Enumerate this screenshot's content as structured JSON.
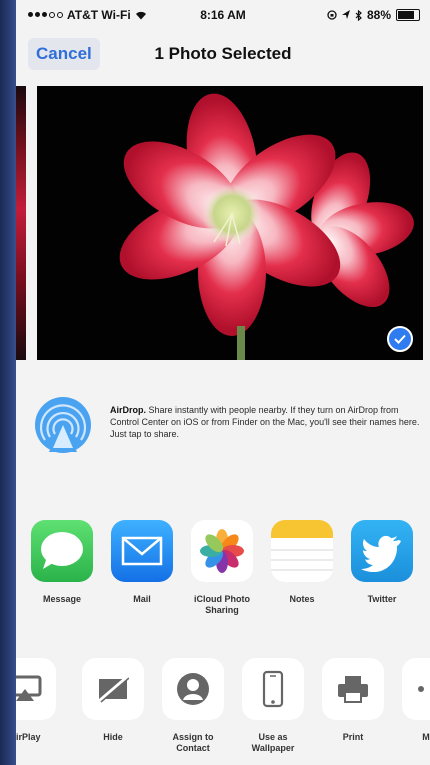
{
  "status_bar": {
    "carrier": "AT&T Wi-Fi",
    "time": "8:16 AM",
    "battery": "88%",
    "battery_level": 0.88
  },
  "nav": {
    "cancel_label": "Cancel",
    "title": "1 Photo Selected"
  },
  "airdrop": {
    "title": "AirDrop.",
    "description": "Share instantly with people nearby. If they turn on AirDrop from Control Center on iOS or from Finder on the Mac, you'll see their names here. Just tap to share."
  },
  "share_apps": [
    {
      "label": "Message",
      "icon": "message-bubble-icon"
    },
    {
      "label": "Mail",
      "icon": "envelope-icon"
    },
    {
      "label": "iCloud Photo Sharing",
      "icon": "photos-pinwheel-icon"
    },
    {
      "label": "Notes",
      "icon": "notes-icon"
    },
    {
      "label": "Twitter",
      "icon": "twitter-bird-icon"
    }
  ],
  "actions": [
    {
      "label": "AirPlay",
      "icon": "airplay-icon"
    },
    {
      "label": "Hide",
      "icon": "hide-icon"
    },
    {
      "label": "Assign to Contact",
      "icon": "contact-icon"
    },
    {
      "label": "Use as Wallpaper",
      "icon": "phone-icon"
    },
    {
      "label": "Print",
      "icon": "printer-icon"
    },
    {
      "label": "More",
      "icon": "more-icon"
    }
  ],
  "colors": {
    "accent": "#2f6fd8",
    "selection_check": "#2f7bf0",
    "message_green": "#34c759",
    "mail_blue": "#1f8ef1",
    "twitter_blue": "#1da1f2",
    "notes_yellow": "#f7c532"
  }
}
